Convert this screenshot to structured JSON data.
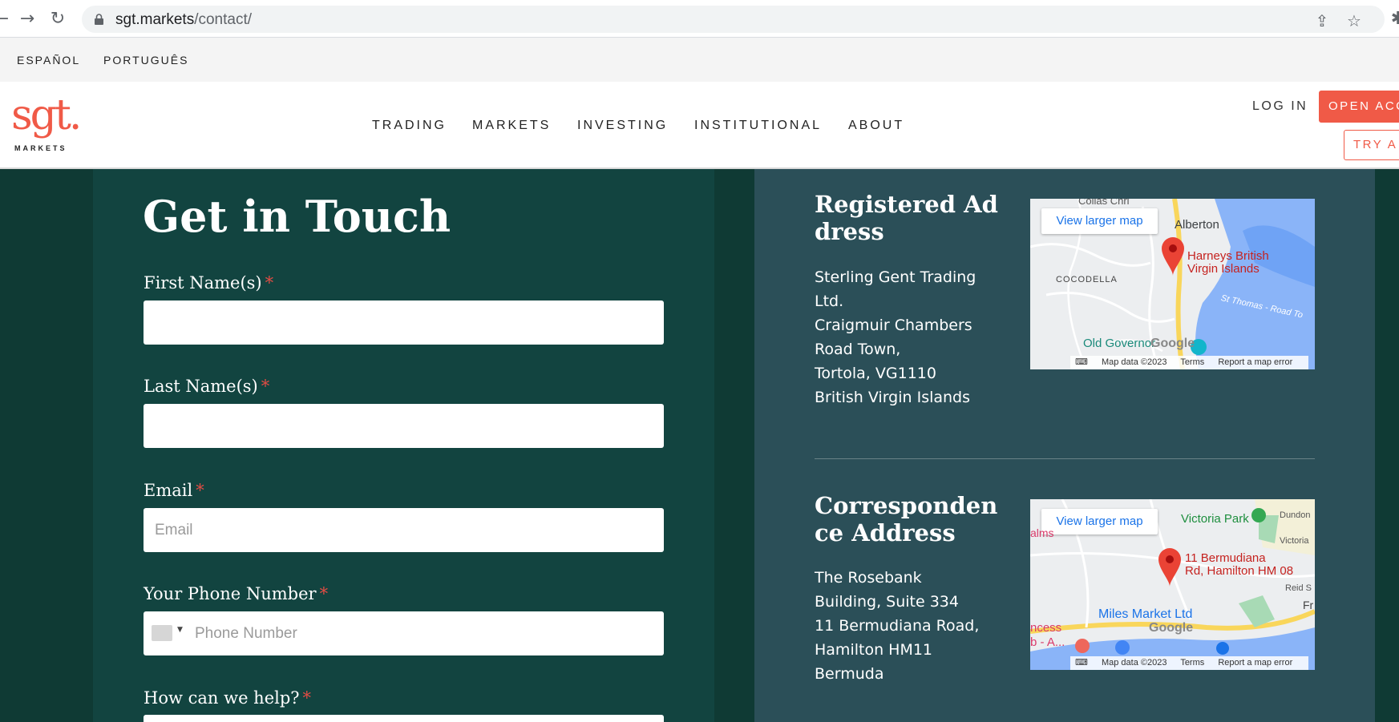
{
  "browser": {
    "url_host": "sgt.markets",
    "url_path": "/contact/"
  },
  "langbar": {
    "items": [
      "ESPAÑOL",
      "PORTUGUÊS"
    ]
  },
  "header": {
    "logo_text": "sgt.",
    "logo_sub": "MARKETS",
    "nav": [
      "TRADING",
      "MARKETS",
      "INVESTING",
      "INSTITUTIONAL",
      "ABOUT"
    ],
    "login": "LOG IN",
    "open_account": "OPEN ACC",
    "try": "TRY A"
  },
  "form": {
    "title": "Get in Touch",
    "required_mark": "*",
    "first_name_label": "First Name(s)",
    "last_name_label": "Last Name(s)",
    "email_label": "Email",
    "email_placeholder": "Email",
    "phone_label": "Your Phone Number",
    "phone_placeholder": "Phone Number",
    "help_label": "How can we help?"
  },
  "registered": {
    "title": "Registered Address",
    "lines": [
      "Sterling Gent Trading Ltd.",
      "Craigmuir Chambers",
      "Road Town,",
      "Tortola, VG1110",
      "British Virgin Islands"
    ],
    "map": {
      "button": "View larger map",
      "place": "Harneys British Virgin Islands",
      "place_line1": "Harneys British",
      "place_line2": "Virgin Islands",
      "labels": [
        "Alberton",
        "COCODELLA",
        "St Thomas - Road To",
        "Old Governor",
        "Colias Chri"
      ],
      "footer_data": "Map data ©2023",
      "footer_terms": "Terms",
      "footer_report": "Report a map error",
      "google": "Google"
    }
  },
  "correspondence": {
    "title": "Correspondence Address",
    "lines": [
      "The Rosebank Building, Suite 334",
      "11 Bermudiana Road,",
      "Hamilton HM11",
      "Bermuda"
    ],
    "map": {
      "button": "View larger map",
      "place_line1": "11 Bermudiana",
      "place_line2": "Rd, Hamilton HM 08",
      "labels": [
        "Victoria Park",
        "Dundon",
        "Victoria",
        "Reid S",
        "Fr",
        "Miles Market Ltd",
        "alms",
        "ncess",
        "b - A..."
      ],
      "footer_data": "Map data ©2023",
      "footer_terms": "Terms",
      "footer_report": "Report a map error",
      "google": "Google"
    }
  },
  "colors": {
    "accent": "#f05a47",
    "form_bg": "#124440",
    "addr_bg": "#2b4f58",
    "page_bg": "#0f3a34"
  }
}
